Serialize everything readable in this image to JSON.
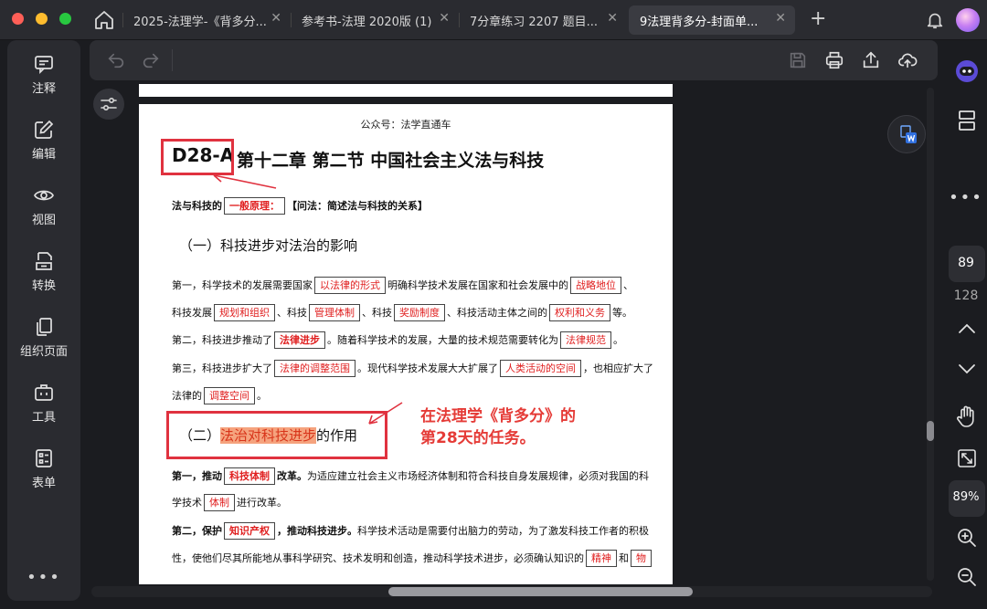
{
  "tabs": [
    {
      "label": "2025-法理学-《背多分...",
      "active": false
    },
    {
      "label": "参考书-法理 2020版 (1)",
      "active": false
    },
    {
      "label": "7分章练习 2207 题目...",
      "active": false
    },
    {
      "label": "9法理背多分-封面单...",
      "active": true
    }
  ],
  "left_sidebar": {
    "items": [
      {
        "label": "注释",
        "icon": "annotation-icon"
      },
      {
        "label": "编辑",
        "icon": "edit-icon"
      },
      {
        "label": "视图",
        "icon": "view-icon"
      },
      {
        "label": "转换",
        "icon": "convert-icon"
      },
      {
        "label": "组织页面",
        "icon": "organize-pages-icon"
      },
      {
        "label": "工具",
        "icon": "tools-icon"
      },
      {
        "label": "表单",
        "icon": "form-icon"
      }
    ],
    "more": "•••"
  },
  "document": {
    "header_note": "公众号：法学直通车",
    "title_code": "D28-A",
    "title_main": "第十二章 第二节 中国社会主义法与科技",
    "intro": {
      "prefix": "法与科技的",
      "keyword": "一般原理：",
      "suffix": "【问法：简述法与科技的关系】"
    },
    "section1": "（一）科技进步对法治的影响",
    "p1": {
      "t1": "第一，科学技术的发展需要国家",
      "k1": "以法律的形式",
      "t2": "明确科学技术发展在国家和社会发展中的",
      "k2": "战略地位",
      "t3": "、"
    },
    "p2": {
      "t1": "科技发展",
      "k1": "规划和组织",
      "t2": "、科技",
      "k2": "管理体制",
      "t3": "、科技",
      "k3": "奖励制度",
      "t4": "、科技活动主体之间的",
      "k4": "权利和义务",
      "t5": "等。"
    },
    "p3": {
      "t1": "第二，科技进步推动了",
      "k1": "法律进步",
      "t2": "。随着科学技术的发展，大量的技术规范需要转化为",
      "k2": "法律规范",
      "t3": "。"
    },
    "p4": {
      "t1": "第三，科技进步扩大了",
      "k1": "法律的调整范围",
      "t2": "。现代科学技术发展大大扩展了",
      "k2": "人类活动的空间",
      "t3": "，也相应扩大了"
    },
    "p5": {
      "t1": "法律的",
      "k1": "调整空间",
      "t2": "。"
    },
    "section2": {
      "prefix": "（二）",
      "highlight": "法治对科技进步",
      "suffix": "的作用"
    },
    "annotation": {
      "line1": "在法理学《背多分》的",
      "line2": "第28天的任务。"
    },
    "p6": {
      "t1": "第一，推动",
      "k1": "科技体制",
      "t2": "改革。",
      "t3": "为适应建立社会主义市场经济体制和符合科技自身发展规律，必须对我国的科"
    },
    "p7": {
      "t1": "学技术",
      "k1": "体制",
      "t2": "进行改革。"
    },
    "p8": {
      "t1": "第二，保护",
      "k1": "知识产权",
      "t2": "，推动科技进步。",
      "t3": "科学技术活动是需要付出脑力的劳动，为了激发科技工作者的积极"
    },
    "p9": {
      "t1": "性，使他们尽其所能地从事科学研究、技术发明和创造，推动科学技术进步，必须确认知识的",
      "k1": "精神",
      "t2": "和",
      "k2": "物"
    }
  },
  "right_sidebar": {
    "current_page": "89",
    "total_pages": "128",
    "zoom": "89%"
  },
  "colors": {
    "accent_red": "#e0323f",
    "keyword_red": "#e02020",
    "highlight": "#f5a37e"
  }
}
